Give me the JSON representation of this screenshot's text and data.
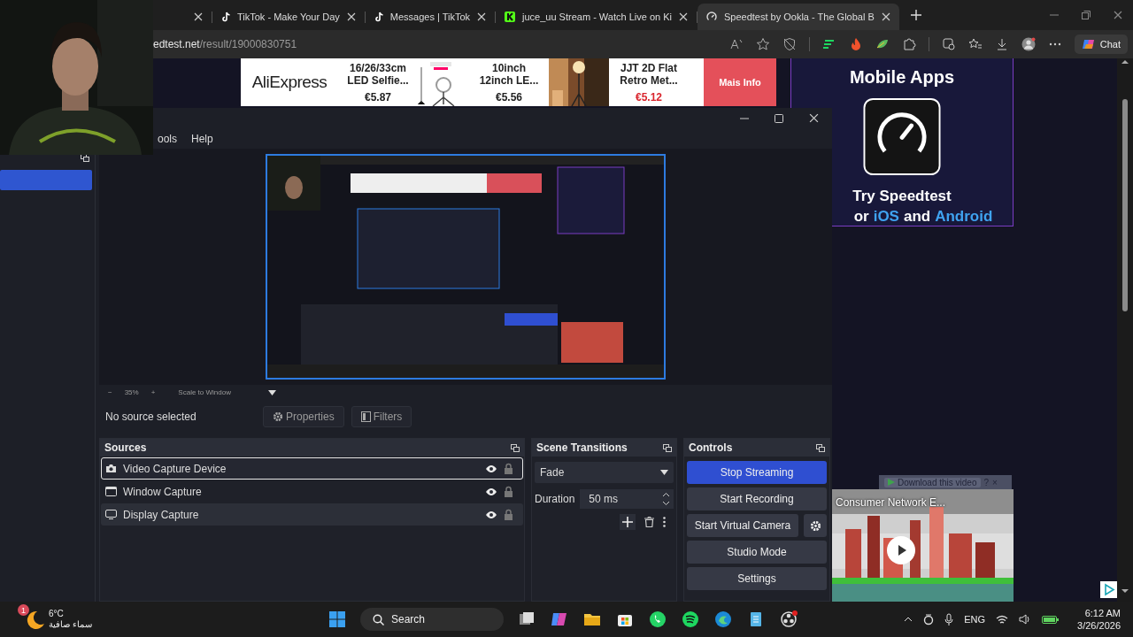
{
  "browser": {
    "tabs": [
      {
        "title": "TikTok - Make Your Day",
        "kind": "note",
        "selected": false
      },
      {
        "title": "Messages | TikTok",
        "kind": "note",
        "selected": false
      },
      {
        "title": "juce_uu Stream - Watch Live on Ki",
        "kind": "square",
        "selected": false
      },
      {
        "title": "Speedtest by Ookla - The Global B",
        "kind": "gauge",
        "selected": true
      }
    ],
    "address": {
      "host": "edtest.net",
      "path": "/result/19000830751"
    },
    "chat_button": "Chat"
  },
  "page": {
    "ad_banner": {
      "brand": "AliExpress",
      "products": [
        {
          "name": "16/26/33cm LED Selfie...",
          "price": "€5.87",
          "sale": false
        },
        {
          "name": "10inch 12inch LE...",
          "price": "€5.56",
          "sale": false
        },
        {
          "name": "JJT 2D Flat Retro Met...",
          "price": "€5.12",
          "sale": true
        }
      ],
      "cta": "Mais Info"
    },
    "promo": {
      "heading": "Mobile Apps",
      "line1": "Try Speedtest",
      "line2": [
        {
          "text": "or",
          "kind": "plain"
        },
        {
          "text": "iOS",
          "kind": "link"
        },
        {
          "text": "and",
          "kind": "plain"
        },
        {
          "text": "Android",
          "kind": "link"
        }
      ]
    },
    "video_ad": {
      "download_label": "Download this video",
      "help": "?",
      "close": "×",
      "title": "Consumer Network E..."
    }
  },
  "obs": {
    "menu": [
      "ools",
      "Help"
    ],
    "zoom": {
      "minus": "−",
      "level": "35%",
      "plus": "+",
      "scale_mode": "Scale to Window"
    },
    "source_status": "No source selected",
    "properties_button": "Properties",
    "filters_button": "Filters",
    "sources": {
      "title": "Sources",
      "items": [
        {
          "name": "Video Capture Device",
          "kind": "camera",
          "selected": true,
          "hovered": false
        },
        {
          "name": "Window Capture",
          "kind": "window",
          "selected": false,
          "hovered": false
        },
        {
          "name": "Display Capture",
          "kind": "display",
          "selected": false,
          "hovered": true
        }
      ]
    },
    "transitions": {
      "title": "Scene Transitions",
      "transition": "Fade",
      "duration_label": "Duration",
      "duration": "50 ms"
    },
    "controls": {
      "title": "Controls",
      "buttons": [
        {
          "label": "Stop Streaming",
          "kind": "button",
          "active": true
        },
        {
          "label": "Start Recording",
          "kind": "button",
          "active": false
        },
        {
          "label": "Start Virtual Camera",
          "kind": "with_settings",
          "active": false
        },
        {
          "label": "Studio Mode",
          "kind": "button",
          "active": false
        },
        {
          "label": "Settings",
          "kind": "button",
          "active": false
        }
      ]
    }
  },
  "taskbar": {
    "temperature": "6°C",
    "weather": "سماء صافية",
    "notification_count": "1",
    "search": "Search",
    "language": "ENG",
    "time": "6:12 AM",
    "date": "3/26/2026"
  }
}
